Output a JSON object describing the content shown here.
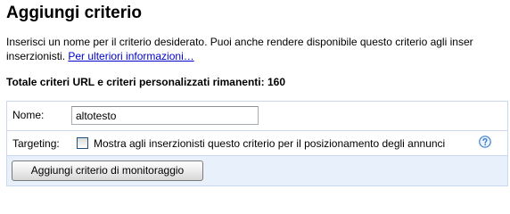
{
  "header": {
    "title": "Aggiungi criterio"
  },
  "description": {
    "line1": "Inserisci un nome per il criterio desiderato. Puoi anche rendere disponibile questo criterio agli inser",
    "line2_prefix": "inserzionisti. ",
    "more_info_link": "Per ulteriori informazioni…"
  },
  "remaining": {
    "label": "Totale criteri URL e criteri personalizzati rimanenti: 160"
  },
  "form": {
    "name_label": "Nome:",
    "name_value": "altotesto",
    "targeting_label": "Targeting:",
    "targeting_checkbox_label": "Mostra agli inserzionisti questo criterio per il posizionamento degli annunci",
    "targeting_checked": false,
    "help_icon": "question-mark-icon",
    "submit_label": "Aggiungi criterio di monitoraggio"
  },
  "colors": {
    "link": "#0000cc",
    "border": "#c9d7f1",
    "action_row_bg": "#e8f0fc",
    "help_icon": "#3a7fd5"
  }
}
